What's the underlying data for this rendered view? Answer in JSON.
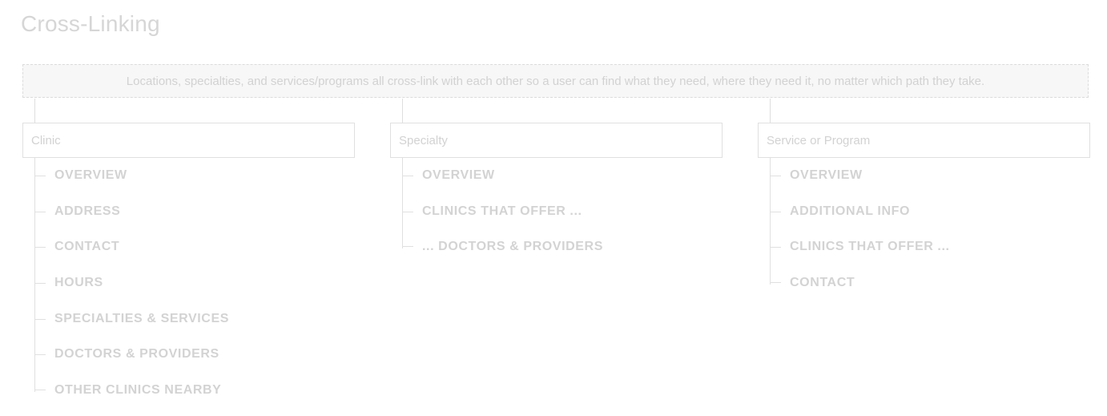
{
  "page": {
    "title": "Cross-Linking",
    "banner": "Locations, specialties, and services/programs all cross-link with each other so a user can find what they need, where they need it, no matter which path they take."
  },
  "columns": [
    {
      "label": "Clinic",
      "items": [
        "OVERVIEW",
        "ADDRESS",
        "CONTACT",
        "HOURS",
        "SPECIALTIES & SERVICES",
        "DOCTORS & PROVIDERS",
        "OTHER CLINICS NEARBY"
      ]
    },
    {
      "label": "Specialty",
      "items": [
        "OVERVIEW",
        "CLINICS THAT OFFER ...",
        "... DOCTORS & PROVIDERS"
      ]
    },
    {
      "label": "Service or Program",
      "items": [
        "OVERVIEW",
        "ADDITIONAL INFO",
        "CLINICS THAT OFFER ...",
        "CONTACT"
      ]
    }
  ],
  "colors": {
    "text": "#d3d3d3",
    "border": "#e0e0e0",
    "banner_bg": "#f7f7f7"
  }
}
